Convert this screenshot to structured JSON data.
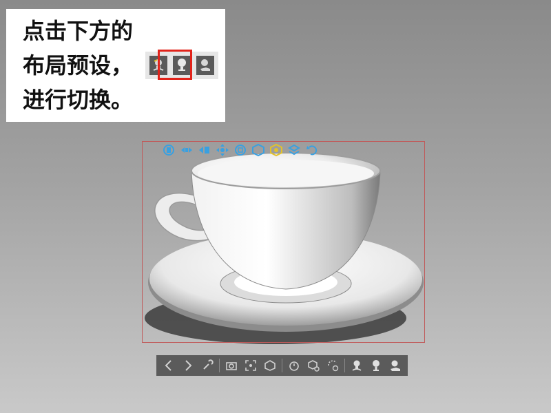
{
  "instruction": {
    "line1": "点击下方的",
    "line2": "布局预设，",
    "line3": "进行切换。"
  },
  "card_icons": [
    "layout-preset-multi-icon",
    "layout-preset-single-icon",
    "layout-preset-hand-icon"
  ],
  "highlight_color": "#e2231a",
  "manipulator_icons": [
    "move-left-icon",
    "move-center-icon",
    "move-right-icon",
    "transform-all-icon",
    "rotate-object-icon",
    "box-view-icon",
    "orbit-icon",
    "snap-icon",
    "undo-icon"
  ],
  "toolbar": {
    "groups": [
      [
        "prev-icon",
        "next-icon",
        "wrench-icon"
      ],
      [
        "screenshot-icon",
        "focus-icon",
        "box-select-icon"
      ],
      [
        "timer-icon",
        "sequence-icon",
        "rotate-timer-icon"
      ],
      [
        "layout-preset-multi-icon",
        "layout-preset-single-icon",
        "layout-preset-hand-icon"
      ]
    ]
  },
  "colors": {
    "accent_blue": "#3aa0e0",
    "accent_yellow": "#e3c22a",
    "toolbar_bg": "#5b5b5b"
  }
}
